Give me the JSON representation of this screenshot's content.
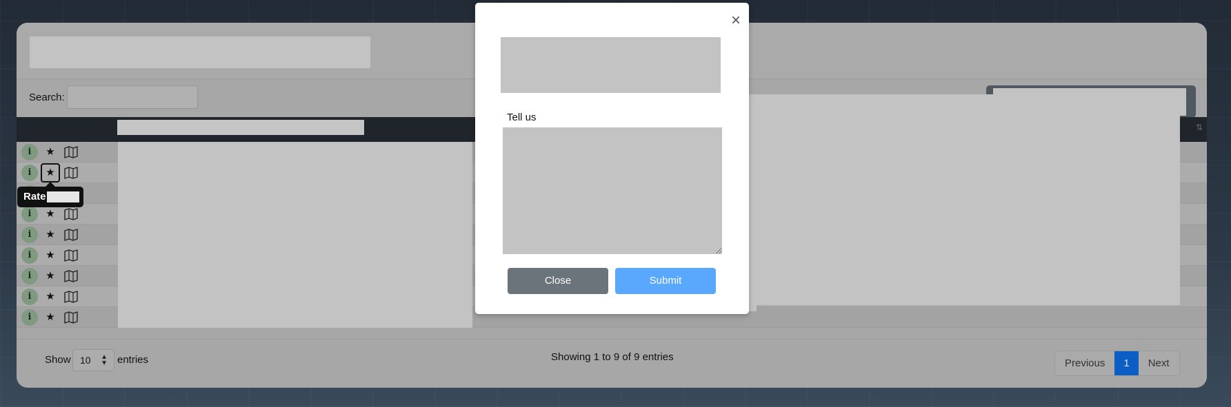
{
  "search": {
    "label": "Search:",
    "placeholder": ""
  },
  "table": {
    "sort_icon": "sort-icon",
    "rows": [
      {
        "info": "i",
        "star": "★"
      },
      {
        "info": "i",
        "star": "★"
      },
      {
        "info": "i",
        "star": "★"
      },
      {
        "info": "i",
        "star": "★"
      },
      {
        "info": "i",
        "star": "★"
      },
      {
        "info": "i",
        "star": "★"
      },
      {
        "info": "i",
        "star": "★"
      },
      {
        "info": "i",
        "star": "★"
      },
      {
        "info": "i",
        "star": "★"
      }
    ]
  },
  "tooltip": {
    "label": "Rate"
  },
  "footer": {
    "show_label": "Show",
    "page_size": "10",
    "entries_label": "entries",
    "info": "Showing 1 to 9 of 9 entries"
  },
  "pagination": {
    "previous": "Previous",
    "current": "1",
    "next": "Next"
  },
  "modal": {
    "close_glyph": "×",
    "prompt_label": "Tell us",
    "close_button": "Close",
    "submit_button": "Submit"
  },
  "colors": {
    "submit": "#5aa8fd",
    "close": "#6b737b",
    "active_page": "#0d5dc6",
    "table_head": "#1f252b"
  }
}
